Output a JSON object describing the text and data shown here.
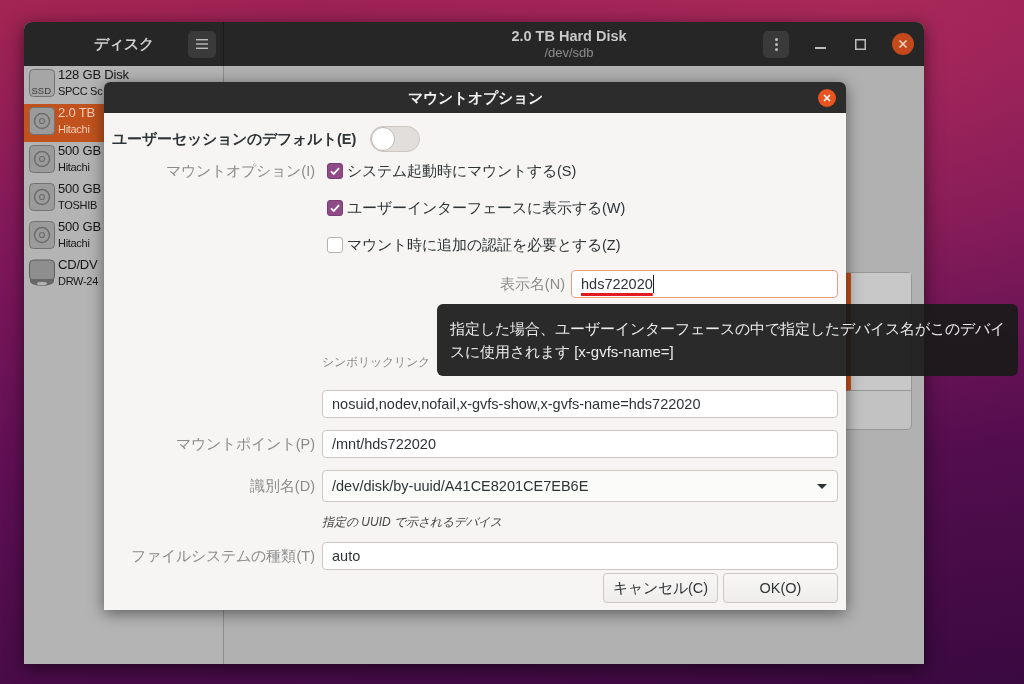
{
  "window": {
    "title": "2.0 TB Hard Disk",
    "subtitle": "/dev/sdb"
  },
  "sidebar": {
    "title": "ディスク",
    "items": [
      {
        "kind": "ssd",
        "icon_label": "SSD",
        "name": "128 GB Disk",
        "detail": "SPCC Sc",
        "selected": false
      },
      {
        "kind": "hdd",
        "name": "2.0 TB",
        "detail": "Hitachi",
        "selected": true
      },
      {
        "kind": "hdd",
        "name": "500 GB",
        "detail": "Hitachi",
        "selected": false
      },
      {
        "kind": "hdd",
        "name": "500 GB",
        "detail": "TOSHIB",
        "selected": false
      },
      {
        "kind": "hdd",
        "name": "500 GB",
        "detail": "Hitachi",
        "selected": false
      },
      {
        "kind": "optical",
        "name": "CD/DV",
        "detail": "DRW-24",
        "selected": false
      }
    ]
  },
  "dialog": {
    "title": "マウントオプション",
    "user_session_default": {
      "label": "ユーザーセッションのデフォルト(E)",
      "on": false
    },
    "mount_options": {
      "label": "マウントオプション(I)",
      "checkboxes": [
        {
          "label": "システム起動時にマウントする(S)",
          "checked": true
        },
        {
          "label": "ユーザーインターフェースに表示する(W)",
          "checked": true
        },
        {
          "label": "マウント時に追加の認証を必要とする(Z)",
          "checked": false
        }
      ]
    },
    "display_name": {
      "label": "表示名(N)",
      "value": "hds722020",
      "focused": true,
      "misspelled": true
    },
    "symlink_icon_label": "シンボリックリンク",
    "fields": [
      {
        "kind": "text",
        "value": "nosuid,nodev,nofail,x-gvfs-show,x-gvfs-name=hds722020"
      },
      {
        "kind": "text",
        "label": "マウントポイント(P)",
        "value": "/mnt/hds722020"
      },
      {
        "kind": "combo",
        "label": "識別名(D)",
        "value": "/dev/disk/by-uuid/A41CE8201CE7EB6E"
      },
      {
        "kind": "note",
        "text": "指定の UUID で示されるデバイス"
      },
      {
        "kind": "text",
        "label": "ファイルシステムの種類(T)",
        "value": "auto"
      }
    ],
    "buttons": [
      {
        "label": "キャンセル(C)"
      },
      {
        "label": "OK(O)"
      }
    ]
  },
  "tooltip": {
    "text": "指定した場合、ユーザーインターフェースの中で指定したデバイス名がこのデバイスに使用されます [x-gvfs-name=]"
  }
}
